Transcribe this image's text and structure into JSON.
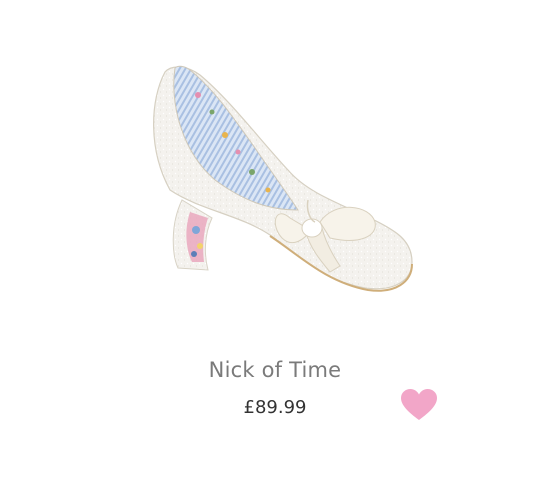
{
  "product": {
    "name": "Nick of Time",
    "price": "£89.99",
    "image_icon": "shoe-image",
    "wishlist_icon": "heart-icon"
  },
  "colors": {
    "name_text": "#7a7a7a",
    "price_text": "#333333",
    "heart": "#f2a6c8",
    "shoe_glitter": "#f3f1ec",
    "shoe_lining": "#b9cde8",
    "bow": "#f7f3ea"
  }
}
